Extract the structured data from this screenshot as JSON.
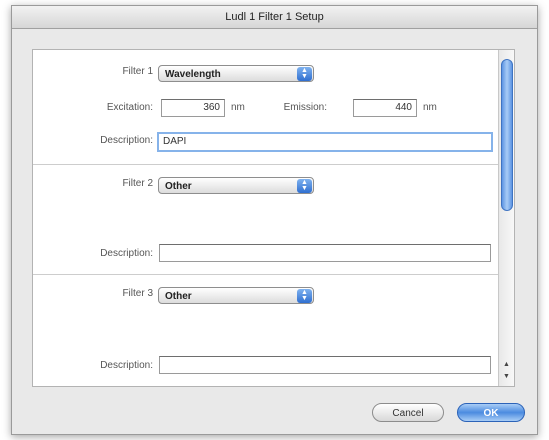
{
  "window": {
    "title": "Ludl 1 Filter 1 Setup"
  },
  "filters": [
    {
      "label": "Filter 1",
      "type": "Wavelength",
      "excitation_label": "Excitation:",
      "excitation_value": "360",
      "excitation_unit": "nm",
      "emission_label": "Emission:",
      "emission_value": "440",
      "emission_unit": "nm",
      "description_label": "Description:",
      "description_value": "DAPI"
    },
    {
      "label": "Filter 2",
      "type": "Other",
      "description_label": "Description:",
      "description_value": ""
    },
    {
      "label": "Filter 3",
      "type": "Other",
      "description_label": "Description:",
      "description_value": ""
    }
  ],
  "buttons": {
    "cancel": "Cancel",
    "ok": "OK"
  },
  "icons": {
    "popup": "up-down-arrows-icon",
    "scroll_up": "scroll-up-arrow-icon",
    "scroll_down": "scroll-down-arrow-icon"
  },
  "colors": {
    "accent": "#4b8be0",
    "focus_ring": "#86b3ea"
  }
}
